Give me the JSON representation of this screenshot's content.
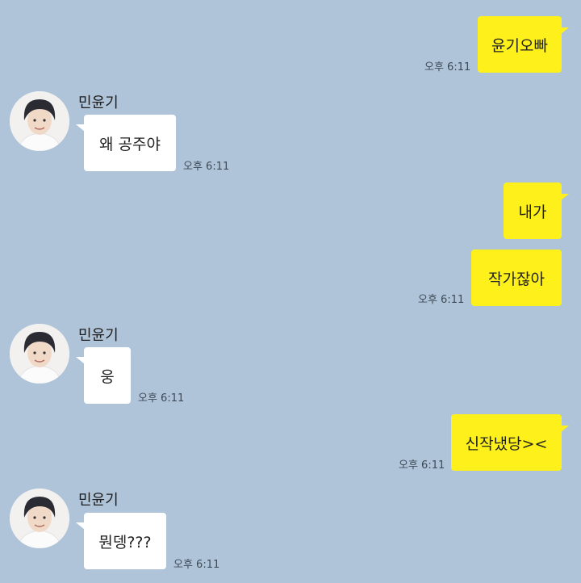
{
  "contact": {
    "name": "민윤기"
  },
  "messages": [
    {
      "from": "me",
      "text": "윤기오빠",
      "time": "오후 6:11"
    },
    {
      "from": "them",
      "text": "왜 공주야",
      "time": "오후 6:11"
    },
    {
      "from": "me",
      "text": "내가",
      "time": ""
    },
    {
      "from": "me",
      "text": "작가잖아",
      "time": "오후 6:11"
    },
    {
      "from": "them",
      "text": "웅",
      "time": "오후 6:11"
    },
    {
      "from": "me",
      "text": "신작냈당><",
      "time": "오후 6:11"
    },
    {
      "from": "them",
      "text": "뭔뎅???",
      "time": "오후 6:11"
    }
  ],
  "colors": {
    "background": "#afc4d9",
    "my_bubble": "#fef01b",
    "their_bubble": "#ffffff"
  },
  "icons": {
    "avatar": "profile-photo"
  }
}
